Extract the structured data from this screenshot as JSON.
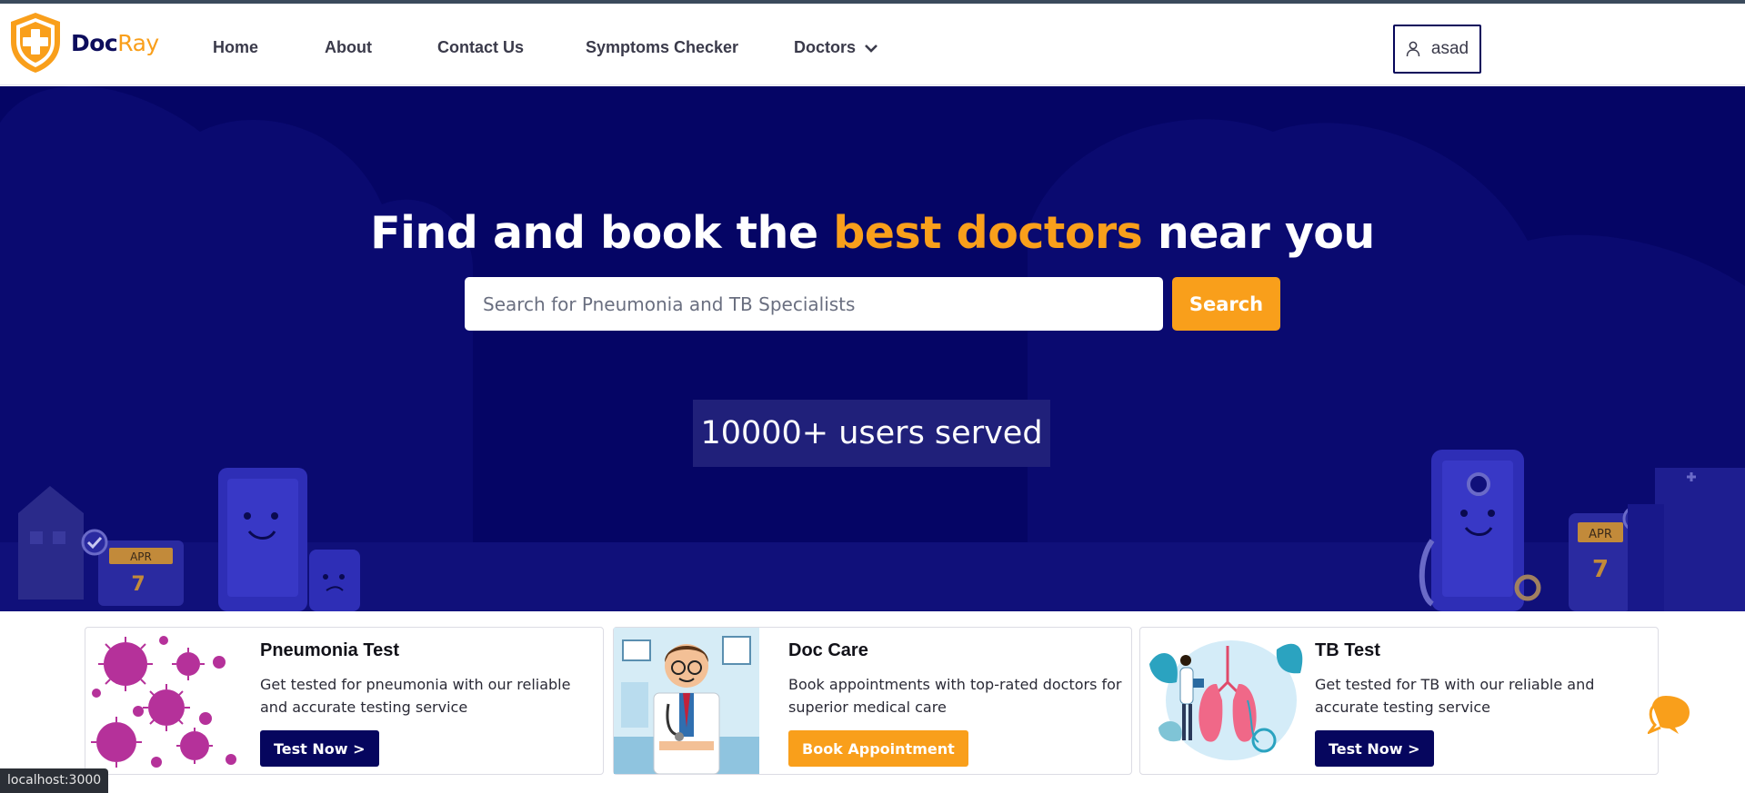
{
  "brand": {
    "name_part1": "Doc",
    "name_part2": "Ray",
    "logo_icon": "shield-plus-icon",
    "primary_color": "#05055a",
    "accent_color": "#f99f1b"
  },
  "nav": {
    "items": [
      {
        "label": "Home"
      },
      {
        "label": "About"
      },
      {
        "label": "Contact Us"
      },
      {
        "label": "Symptoms Checker"
      },
      {
        "label": "Doctors"
      }
    ],
    "doctors_icon": "chevron-down-icon",
    "user": {
      "label": "asad",
      "icon": "user-icon"
    }
  },
  "hero": {
    "title_part1": "Find and book the ",
    "title_highlight": "best doctors",
    "title_part2": " near you",
    "search_placeholder": "Search for Pneumonia and TB Specialists",
    "search_value": "",
    "search_button": "Search",
    "stat": "10000+ users served",
    "background_color": "#050565"
  },
  "cards": [
    {
      "title": "Pneumonia Test",
      "description": "Get tested for pneumonia with our reliable and accurate testing service",
      "button": "Test Now >",
      "illustration": "virus-illustration"
    },
    {
      "title": "Doc Care",
      "description": "Book appointments with top-rated doctors for superior medical care",
      "button": "Book Appointment",
      "illustration": "doctor-illustration"
    },
    {
      "title": "TB Test",
      "description": "Get tested for TB with our reliable and accurate testing service",
      "button": "Test Now >",
      "illustration": "lungs-illustration"
    }
  ],
  "chat_icon": "chat-bubble-icon",
  "status_url": "localhost:3000"
}
